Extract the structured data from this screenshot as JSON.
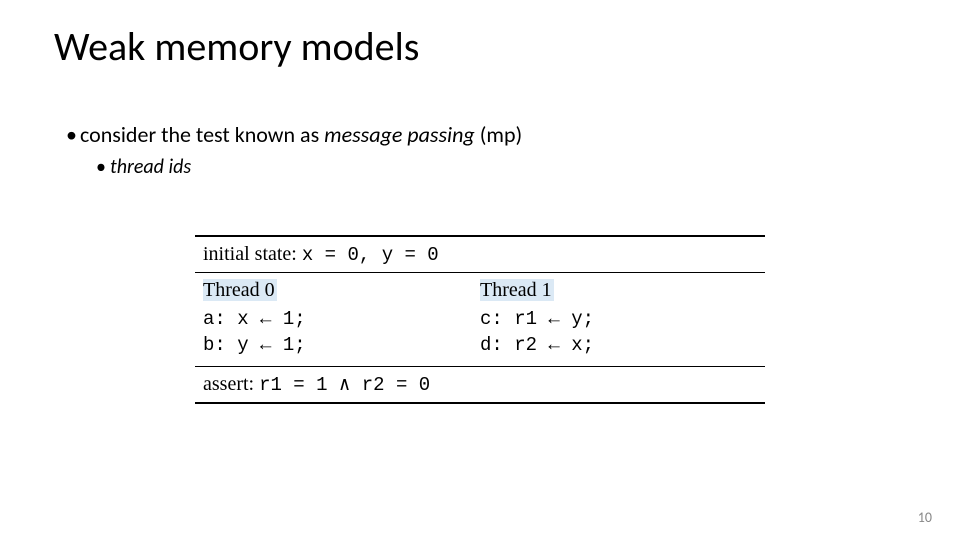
{
  "title": "Weak memory models",
  "bullets": {
    "l1_prefix": "consider the test known as ",
    "l1_em": "message passing",
    "l1_suffix": " (mp)",
    "l2": "thread ids"
  },
  "table": {
    "initial_state_label": "initial state: ",
    "initial_state_expr": "x = 0, y = 0",
    "thread0": {
      "head": "Thread 0",
      "line_a": "a: x ← 1;",
      "line_b": "b: y ← 1;"
    },
    "thread1": {
      "head": "Thread 1",
      "line_c": "c: r1 ← y;",
      "line_d": "d: r2 ← x;"
    },
    "assert_label": "assert: ",
    "assert_expr": "r1 = 1 ∧ r2 = 0"
  },
  "page_number": "10"
}
